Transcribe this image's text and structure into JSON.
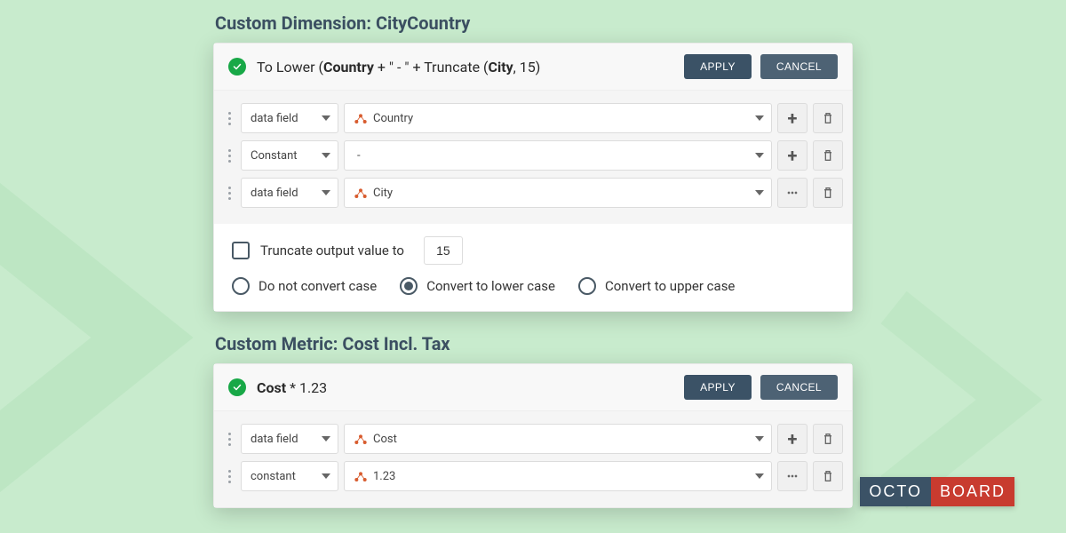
{
  "section1": {
    "title": "Custom Dimension: CityCountry",
    "formula_prefix": "To Lower (",
    "formula_country": "Country",
    "formula_mid1": " + \" - \" + Truncate (",
    "formula_city": "City",
    "formula_suffix": ", 15)",
    "apply": "APPLY",
    "cancel": "CANCEL",
    "rows": [
      {
        "type": "data field",
        "value": "Country",
        "has_dots": true,
        "action_more": false
      },
      {
        "type": "Constant",
        "value": "-",
        "has_dots": false,
        "action_more": false
      },
      {
        "type": "data field",
        "value": "City",
        "has_dots": true,
        "action_more": true
      }
    ],
    "truncate_label": "Truncate output value to",
    "truncate_value": "15",
    "radios": {
      "none": "Do not convert case",
      "lower": "Convert to lower case",
      "upper": "Convert to upper case",
      "selected": "lower"
    }
  },
  "section2": {
    "title": "Custom Metric: Cost Incl. Tax",
    "formula_cost": "Cost",
    "formula_rest": " * 1.23",
    "apply": "APPLY",
    "cancel": "CANCEL",
    "rows": [
      {
        "type": "data field",
        "value": "Cost",
        "has_dots": true,
        "action_more": false
      },
      {
        "type": "constant",
        "value": "1.23",
        "has_dots": true,
        "action_more": true
      }
    ]
  },
  "brand": {
    "a": "OCTO",
    "b": "BOARD"
  }
}
